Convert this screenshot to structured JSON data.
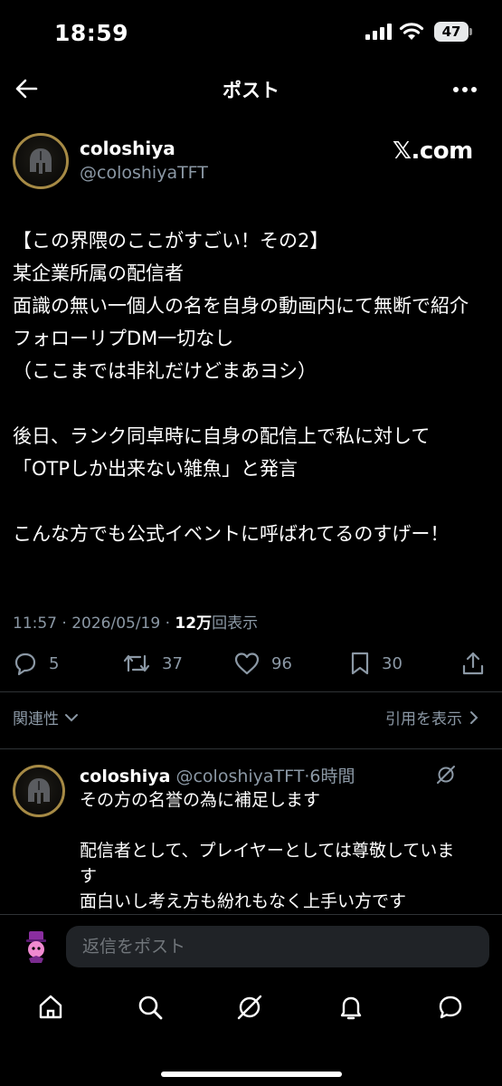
{
  "status_bar": {
    "time": "18:59",
    "battery": "47"
  },
  "header": {
    "title": "ポスト"
  },
  "post": {
    "author_name": "coloshiya",
    "author_handle": "@coloshiyaTFT",
    "watermark": "𝕏.com",
    "body": "【この界隈のここがすごい！その2】\n某企業所属の配信者\n面識の無い一個人の名を自身の動画内にて無断で紹介\nフォローリプDM一切なし\n（ここまでは非礼だけどまあヨシ）\n\n後日、ランク同卓時に自身の配信上で私に対して\n「OTPしか出来ない雑魚」と発言\n\nこんな方でも公式イベントに呼ばれてるのすげー！",
    "time": "11:57 · 2026/05/19 · ",
    "views_count": "12万",
    "views_label": "回表示",
    "stats": {
      "replies": "5",
      "reposts": "37",
      "likes": "96",
      "bookmarks": "30"
    }
  },
  "filters": {
    "sort_label": "関連性",
    "quotes_label": "引用を表示"
  },
  "reply": {
    "author_name": "coloshiya",
    "author_handle": "@coloshiyaTFT",
    "age": "·6時間",
    "body": "その方の名誉の為に補足します\n\n配信者として、プレイヤーとしては尊敬していま\nす\n面白いし考え方も紛れもなく上手い方です"
  },
  "composer": {
    "placeholder": "返信をポスト"
  },
  "tabs": [
    "home",
    "search",
    "grok",
    "notifications",
    "messages"
  ]
}
